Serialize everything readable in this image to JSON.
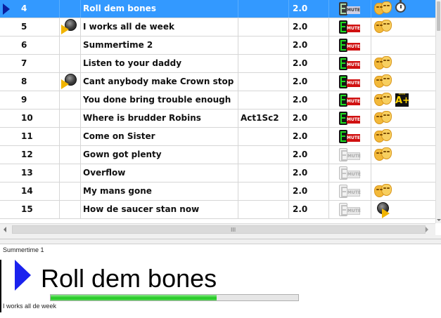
{
  "colors": {
    "selected_row": "#3399ff",
    "play_arrow": "#0a1f9e",
    "current_arrow": "#1a22ee",
    "mute_label": "#d01010",
    "mute_light": "#1fdc1f",
    "progress_fill": "#20c820"
  },
  "songs": [
    {
      "num": "4",
      "title": "Roll dem bones",
      "scene": "",
      "version": "2.0",
      "speaker": false,
      "mute": "active",
      "masks": true,
      "extra": "stopwatch-icon",
      "selected": true,
      "playing": true
    },
    {
      "num": "5",
      "title": "I works all de week",
      "scene": "",
      "version": "2.0",
      "speaker": true,
      "mute": "active",
      "masks": true,
      "extra": "",
      "selected": false,
      "playing": false
    },
    {
      "num": "6",
      "title": "Summertime 2",
      "scene": "",
      "version": "2.0",
      "speaker": false,
      "mute": "active",
      "masks": false,
      "extra": "",
      "selected": false,
      "playing": false
    },
    {
      "num": "7",
      "title": "Listen to your daddy",
      "scene": "",
      "version": "2.0",
      "speaker": false,
      "mute": "active",
      "masks": true,
      "extra": "",
      "selected": false,
      "playing": false
    },
    {
      "num": "8",
      "title": "Cant anybody make Crown stop",
      "scene": "",
      "version": "2.0",
      "speaker": true,
      "mute": "active",
      "masks": true,
      "extra": "",
      "selected": false,
      "playing": false
    },
    {
      "num": "9",
      "title": "You done bring trouble enough",
      "scene": "",
      "version": "2.0",
      "speaker": false,
      "mute": "active",
      "masks": true,
      "extra": "a-plus-icon",
      "selected": false,
      "playing": false
    },
    {
      "num": "10",
      "title": "Where is brudder Robins",
      "scene": "Act1Sc2",
      "version": "2.0",
      "speaker": false,
      "mute": "active",
      "masks": true,
      "extra": "",
      "selected": false,
      "playing": false
    },
    {
      "num": "11",
      "title": "Come on Sister",
      "scene": "",
      "version": "2.0",
      "speaker": false,
      "mute": "active",
      "masks": true,
      "extra": "",
      "selected": false,
      "playing": false
    },
    {
      "num": "12",
      "title": "Gown got plenty",
      "scene": "",
      "version": "2.0",
      "speaker": false,
      "mute": "inactive",
      "masks": true,
      "extra": "",
      "selected": false,
      "playing": false
    },
    {
      "num": "13",
      "title": "Overflow",
      "scene": "",
      "version": "2.0",
      "speaker": false,
      "mute": "inactive",
      "masks": false,
      "extra": "",
      "selected": false,
      "playing": false
    },
    {
      "num": "14",
      "title": "My mans gone",
      "scene": "",
      "version": "2.0",
      "speaker": false,
      "mute": "inactive",
      "masks": true,
      "extra": "",
      "selected": false,
      "playing": false
    },
    {
      "num": "15",
      "title": "How de saucer stan now",
      "scene": "",
      "version": "2.0",
      "speaker": false,
      "mute": "inactive",
      "masks": false,
      "extra": "speaker-icon",
      "selected": false,
      "playing": false
    }
  ],
  "mute_label": "MUTE",
  "a_plus_label": "A+",
  "a_plus_dots": "°°°°",
  "hscroll_grip": "III",
  "now_playing": {
    "previous": "Summertime 1",
    "current": "Roll dem bones",
    "next": "I works all de week",
    "progress_fraction": 0.67
  }
}
